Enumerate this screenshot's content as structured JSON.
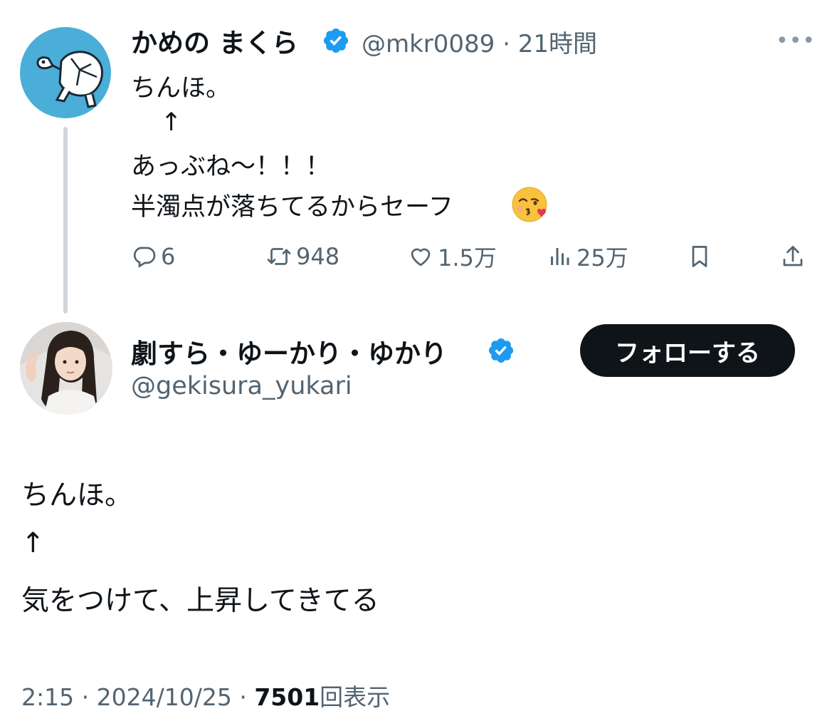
{
  "quoted_tweet": {
    "display_name": "かめの まくら",
    "handle": "@mkr0089",
    "separator": "·",
    "time": "21時間",
    "more": "•••",
    "lines": [
      "ちんほ。",
      "↑",
      "あっぶね〜！！！",
      "半濁点が落ちてるからセーフ"
    ],
    "emoji": "face-throwing-a-kiss",
    "actions": {
      "replies": "6",
      "retweets": "948",
      "likes": "1.5万",
      "views": "25万"
    }
  },
  "main_tweet": {
    "display_name": "劇すら・ゆーかり・ゆかり",
    "handle": "@gekisura_yukari",
    "follow_label": "フォローする",
    "lines": [
      "ちんほ。",
      "↑",
      "気をつけて、上昇してきてる"
    ],
    "footer": {
      "time": "2:15",
      "separator": "·",
      "date": "2024/10/25",
      "views_count": "7501",
      "views_label": "回表示"
    }
  },
  "colors": {
    "text": "#0f1419",
    "muted": "#536471",
    "verified": "#1d9bf0",
    "thread_line": "#d0d6db",
    "avatar1_bg": "#4aaed8",
    "follow_bg": "#0f1419"
  },
  "icons": [
    "verified-badge-icon",
    "more-icon",
    "reply-icon",
    "retweet-icon",
    "like-icon",
    "views-icon",
    "bookmark-icon",
    "share-icon"
  ]
}
